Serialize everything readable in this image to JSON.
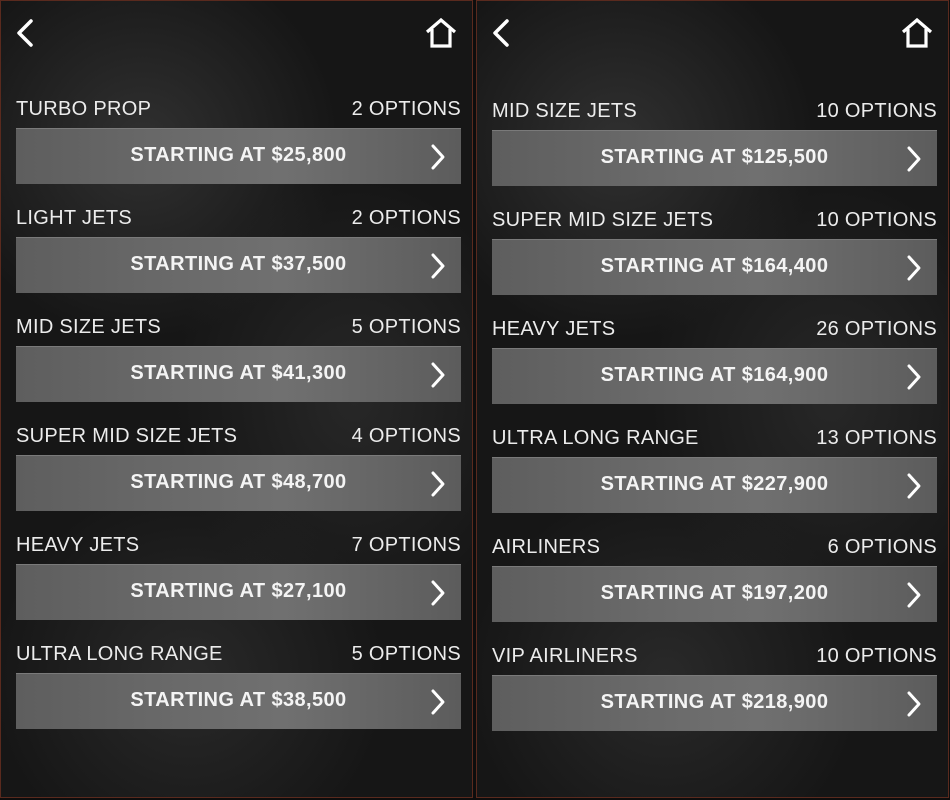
{
  "screens": [
    {
      "categories": [
        {
          "name": "TURBO PROP",
          "options": "2 OPTIONS",
          "price": "STARTING AT $25,800"
        },
        {
          "name": "LIGHT JETS",
          "options": "2 OPTIONS",
          "price": "STARTING AT $37,500"
        },
        {
          "name": "MID SIZE JETS",
          "options": "5 OPTIONS",
          "price": "STARTING AT $41,300"
        },
        {
          "name": "SUPER MID SIZE JETS",
          "options": "4 OPTIONS",
          "price": "STARTING AT $48,700"
        },
        {
          "name": "HEAVY JETS",
          "options": "7 OPTIONS",
          "price": "STARTING AT $27,100"
        },
        {
          "name": "ULTRA LONG RANGE",
          "options": "5 OPTIONS",
          "price": "STARTING AT $38,500"
        }
      ]
    },
    {
      "categories": [
        {
          "name": "MID SIZE JETS",
          "options": "10 OPTIONS",
          "price": "STARTING AT $125,500"
        },
        {
          "name": "SUPER MID SIZE JETS",
          "options": "10 OPTIONS",
          "price": "STARTING AT $164,400"
        },
        {
          "name": "HEAVY JETS",
          "options": "26 OPTIONS",
          "price": "STARTING AT $164,900"
        },
        {
          "name": "ULTRA LONG RANGE",
          "options": "13 OPTIONS",
          "price": "STARTING AT $227,900"
        },
        {
          "name": "AIRLINERS",
          "options": "6 OPTIONS",
          "price": "STARTING AT $197,200"
        },
        {
          "name": "VIP AIRLINERS",
          "options": "10 OPTIONS",
          "price": "STARTING AT $218,900"
        }
      ]
    }
  ],
  "icons": {
    "back": "chevron-left-icon",
    "home": "home-icon",
    "row_arrow": "chevron-right-icon"
  },
  "colors": {
    "background": "#161616",
    "button": "#6b6b6b",
    "text": "#ececec",
    "border": "#5a2a1e"
  }
}
